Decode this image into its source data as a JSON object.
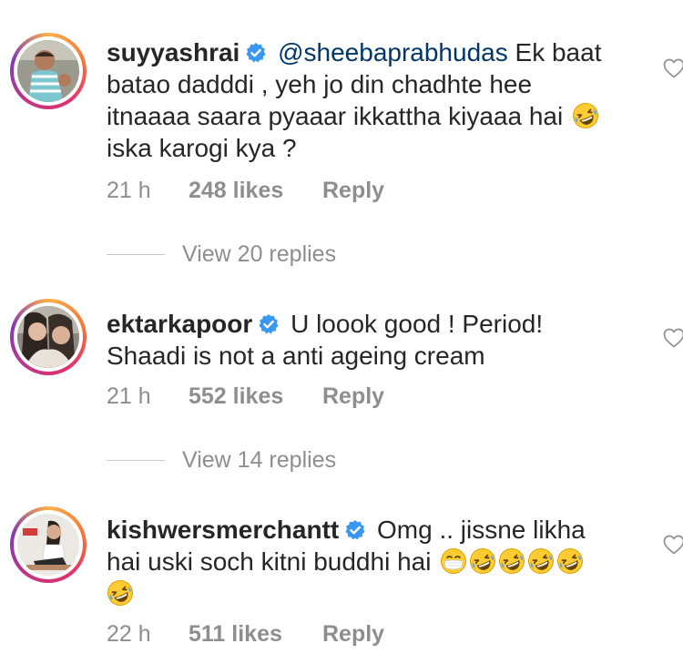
{
  "comments": [
    {
      "username": "suyyashrai",
      "mention": "@sheebaprabhudas",
      "lines": [
        "Ek baat",
        "batao dadddi , yeh jo din chadhte hee",
        "itnaaaa saara pyaaar ikkattha kiyaaa hai",
        "iska karogi kya ?"
      ],
      "time": "21 h",
      "likes": "248 likes",
      "reply": "Reply",
      "view_replies": "View 20 replies"
    },
    {
      "username": "ektarkapoor",
      "lines": [
        "U loook good ! Period!",
        "Shaadi is not a anti ageing cream"
      ],
      "time": "21 h",
      "likes": "552 likes",
      "reply": "Reply",
      "view_replies": "View 14 replies"
    },
    {
      "username": "kishwersmerchantt",
      "lines": [
        "Omg .. jissne likha",
        "hai uski soch kitni buddhi hai"
      ],
      "time": "22 h",
      "likes": "511 likes",
      "reply": "Reply"
    }
  ],
  "icons": {
    "verified": "verified-badge-icon",
    "like": "heart-icon",
    "emoji_laugh": "rolling-on-floor-laughing-emoji",
    "emoji_mask": "face-with-medical-mask-emoji"
  },
  "colors": {
    "verified": "#3897f0",
    "mention": "#00376b",
    "meta": "#8e8e8e",
    "text": "#262626"
  }
}
